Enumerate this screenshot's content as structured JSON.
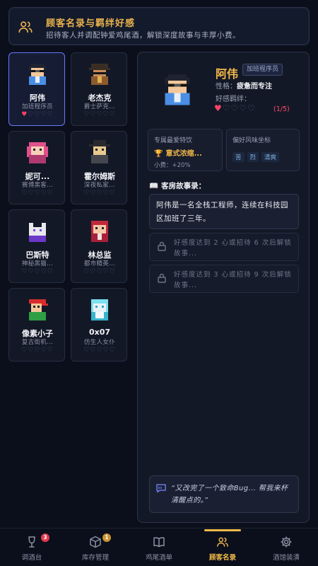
{
  "header": {
    "title": "顾客名录与羁绊好感",
    "subtitle": "招待客人并调配钟爱鸡尾酒，解锁深度故事与丰厚小费。",
    "icon": "people-icon"
  },
  "customers": [
    {
      "name": "阿伟",
      "role": "加班程序员",
      "hearts_filled": 1,
      "hearts_total": 5,
      "selected": true
    },
    {
      "name": "老杰克",
      "role": "爵士萨克...",
      "hearts_filled": 0,
      "hearts_total": 5,
      "selected": false
    },
    {
      "name": "妮可...",
      "role": "赛博黑客...",
      "hearts_filled": 0,
      "hearts_total": 5,
      "selected": false
    },
    {
      "name": "霍尔姆斯",
      "role": "深夜私家...",
      "hearts_filled": 0,
      "hearts_total": 5,
      "selected": false
    },
    {
      "name": "巴斯特",
      "role": "神秘黑猫...",
      "hearts_filled": 0,
      "hearts_total": 5,
      "selected": false
    },
    {
      "name": "林总监",
      "role": "都市精英...",
      "hearts_filled": 0,
      "hearts_total": 5,
      "selected": false
    },
    {
      "name": "像素小子",
      "role": "复古街机...",
      "hearts_filled": 0,
      "hearts_total": 5,
      "selected": false
    },
    {
      "name": "0x07",
      "role": "仿生人女仆",
      "hearts_filled": 0,
      "hearts_total": 5,
      "selected": false
    }
  ],
  "detail": {
    "name": "阿伟",
    "tag": "加班程序员",
    "personality_label": "性格：",
    "personality": "疲惫而专注",
    "bond_label": "好感羁绊：",
    "hearts_filled": 1,
    "hearts_total": 5,
    "progress": "(1/5)",
    "favorite": {
      "label": "专属最爱特饮",
      "drink": "意式浓缩...",
      "tip": "小费：+20%"
    },
    "style": {
      "label": "偏好风味坐标",
      "tags": [
        "苦",
        "烈",
        "清爽"
      ]
    },
    "story_title": "客房故事录：",
    "story_text": "阿伟是一名全栈工程师，连续在科技园区加班了三年。",
    "locked": [
      "好感度达到 2 心或招待 6 次后解锁故事...",
      "好感度达到 3 心或招待 9 次后解锁故事..."
    ],
    "quote": "“又改完了一个致命Bug... 帮我来杯清醒点的。”"
  },
  "nav": [
    {
      "label": "调酒台",
      "icon": "wine-glass-icon",
      "badge": "3",
      "active": false
    },
    {
      "label": "库存管理",
      "icon": "box-icon",
      "badge": "1",
      "active": false
    },
    {
      "label": "鸡尾酒单",
      "icon": "book-icon",
      "badge": "",
      "active": false
    },
    {
      "label": "顾客名录",
      "icon": "people-icon",
      "badge": "",
      "active": true
    },
    {
      "label": "酒馆装潢",
      "icon": "gear-icon",
      "badge": "",
      "active": false
    }
  ],
  "colors": {
    "accent": "#f2b94a",
    "heart": "#ff4466",
    "selected_border": "#6a78ff",
    "background": "#0b0f1c"
  }
}
